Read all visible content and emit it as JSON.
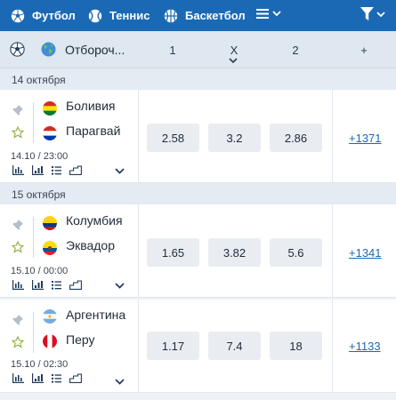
{
  "sports_bar": {
    "items": [
      {
        "label": "Футбол"
      },
      {
        "label": "Теннис"
      },
      {
        "label": "Баскетбол"
      }
    ]
  },
  "championship": {
    "name": "Отбороч...",
    "col_1": "1",
    "col_x": "X",
    "col_2": "2",
    "col_more": "+"
  },
  "groups": [
    {
      "date": "14 октября"
    },
    {
      "date": "15 октября"
    }
  ],
  "matches": [
    {
      "team1": "Боливия",
      "team2": "Парагвай",
      "datetime": "14.10 / 23:00",
      "odds": [
        "2.58",
        "3.2",
        "2.86"
      ],
      "more": "+1371"
    },
    {
      "team1": "Колумбия",
      "team2": "Эквадор",
      "datetime": "15.10 / 00:00",
      "odds": [
        "1.65",
        "3.82",
        "5.6"
      ],
      "more": "+1341"
    },
    {
      "team1": "Аргентина",
      "team2": "Перу",
      "datetime": "15.10 / 02:30",
      "odds": [
        "1.17",
        "7.4",
        "18"
      ],
      "more": "+1133"
    }
  ],
  "colors": {
    "brand_blue": "#1b69b4",
    "header_bg": "#dfe7f1",
    "odd_bg": "#e9edf2",
    "pin_gray": "#b5bec9",
    "star_green": "#8cae3a"
  }
}
